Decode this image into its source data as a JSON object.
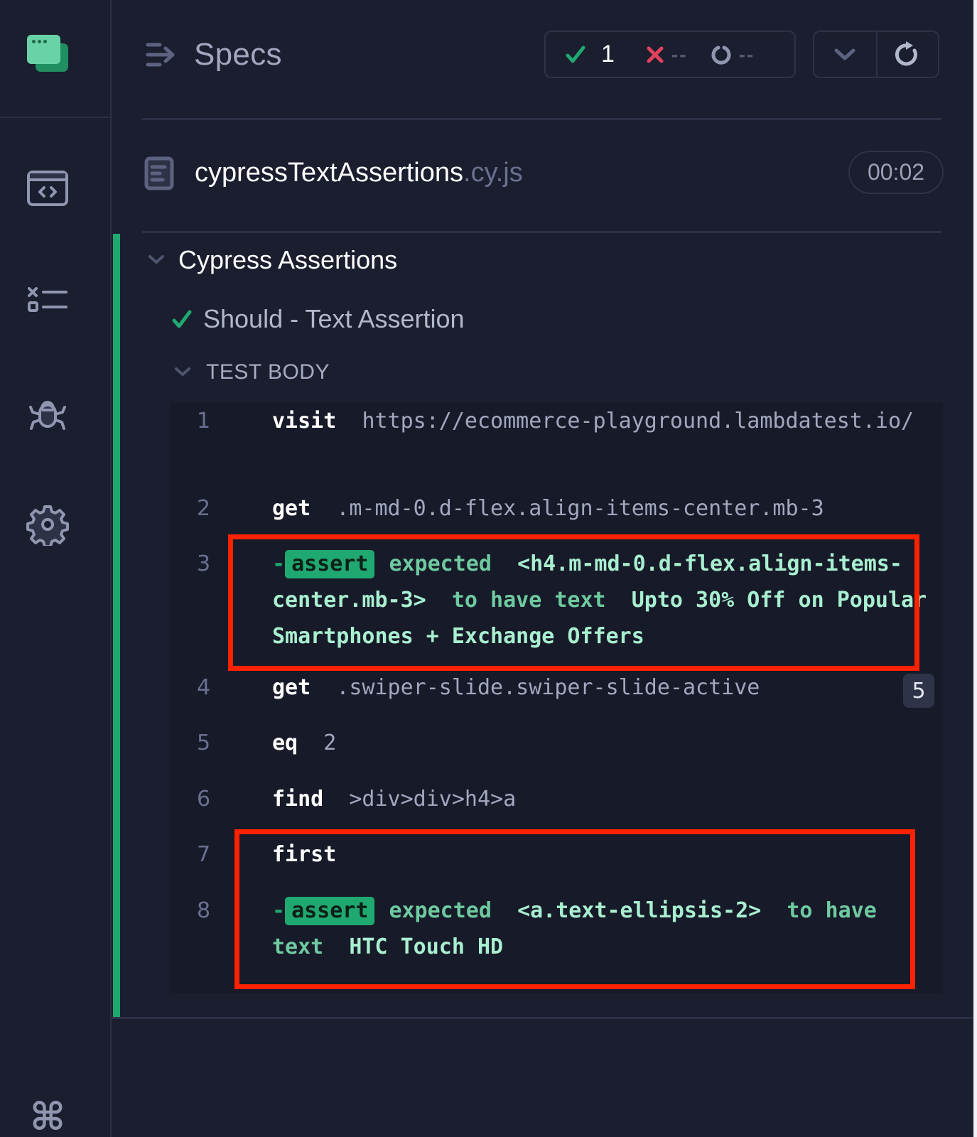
{
  "sidebar": {
    "logo": "cypress-app-logo",
    "items": [
      {
        "name": "specs",
        "icon": "code-window-icon"
      },
      {
        "name": "runs",
        "icon": "test-list-icon"
      },
      {
        "name": "debug",
        "icon": "bug-icon"
      },
      {
        "name": "settings",
        "icon": "gear-icon"
      }
    ],
    "shortcut_icon": "command-key-icon",
    "shortcut_glyph": "⌘"
  },
  "header": {
    "title": "Specs",
    "stats": {
      "passed": "1",
      "failed": "--",
      "pending": "--"
    }
  },
  "spec": {
    "name": "cypressTextAssertions",
    "extension": ".cy.js",
    "duration": "00:02"
  },
  "suite": {
    "title": "Cypress Assertions",
    "test": {
      "title": "Should - Text Assertion",
      "status": "passed",
      "section": "TEST BODY"
    }
  },
  "commands": [
    {
      "num": "1",
      "method": "visit",
      "message": "https://ecommerce-playground.lambdatest.io/"
    },
    {
      "num": "2",
      "method": "get",
      "message": ".m-md-0.d-flex.align-items-center.mb-3"
    },
    {
      "num": "3",
      "method": "assert",
      "expected": "expected",
      "subject": "<h4.m-md-0.d-flex.align-items-center.mb-3>",
      "verb": "to have text",
      "value": "Upto 30% Off on Popular Smartphones + Exchange Offers"
    },
    {
      "num": "4",
      "method": "get",
      "message": ".swiper-slide.swiper-slide-active",
      "count": "5"
    },
    {
      "num": "5",
      "method": "eq",
      "message": "2"
    },
    {
      "num": "6",
      "method": "find",
      "message": ">div>div>h4>a"
    },
    {
      "num": "7",
      "method": "first",
      "message": ""
    },
    {
      "num": "8",
      "method": "assert",
      "expected": "expected",
      "subject": "<a.text-ellipsis-2>",
      "verb": "to have text",
      "value": "HTC Touch HD"
    }
  ],
  "colors": {
    "passed": "#1fa971",
    "failed": "#e2425a",
    "highlight": "#ff2200",
    "background": "#1b1e2e"
  }
}
